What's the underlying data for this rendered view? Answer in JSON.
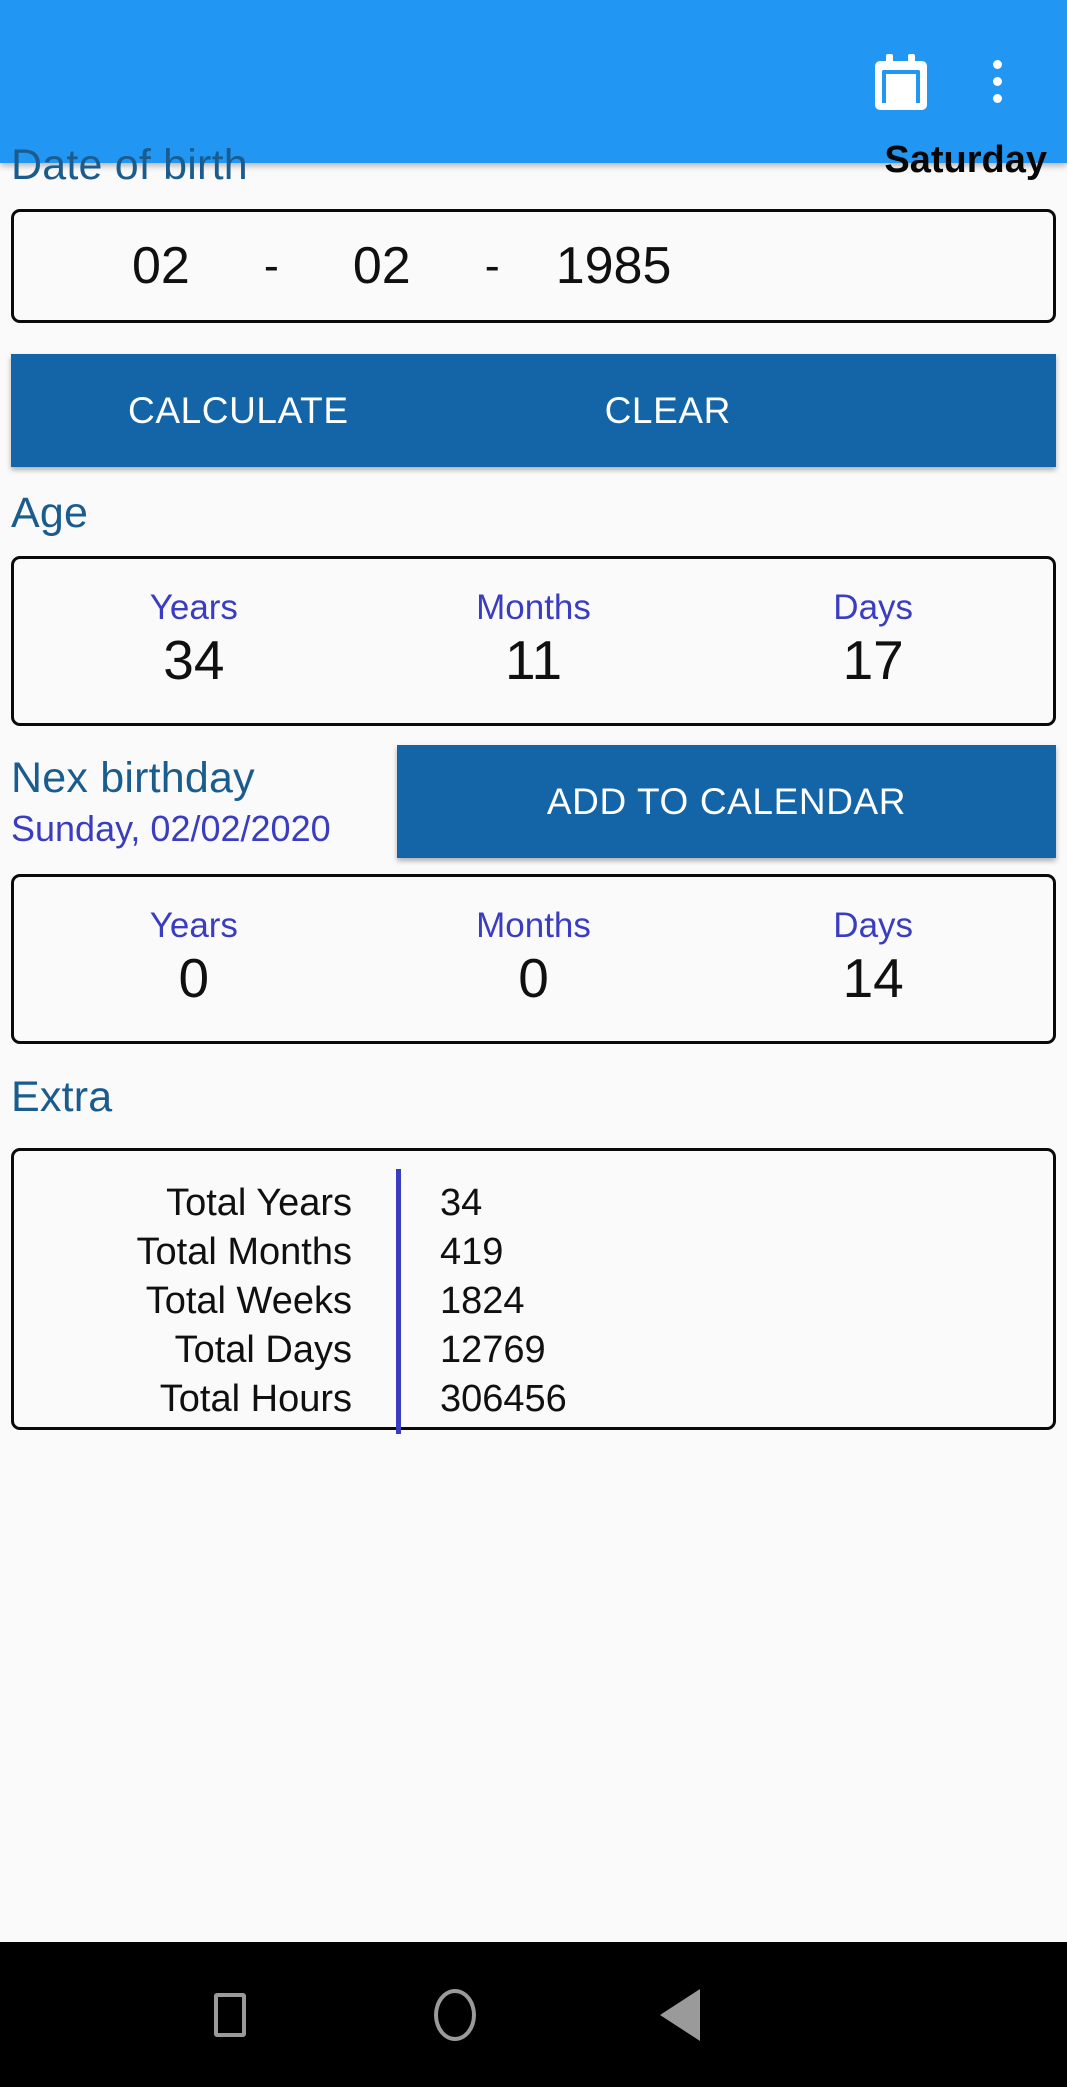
{
  "appbar": {
    "background": "#2196F3",
    "calendar_icon": "calendar-icon",
    "overflow_icon": "more-vertical-icon"
  },
  "dob": {
    "section_label": "Date of birth",
    "weekday": "Saturday",
    "day": "02",
    "month": "02",
    "year": "1985",
    "separator": "-"
  },
  "actions": {
    "calculate_label": "CALCULATE",
    "clear_label": "CLEAR",
    "button_color": "#1365A8"
  },
  "age": {
    "section_label": "Age",
    "columns": [
      {
        "label": "Years",
        "value": "34"
      },
      {
        "label": "Months",
        "value": "11"
      },
      {
        "label": "Days",
        "value": "17"
      }
    ]
  },
  "next_birthday": {
    "section_label": "Nex birthday",
    "date_text": "Sunday, 02/02/2020",
    "add_to_calendar_label": "ADD TO CALENDAR",
    "columns": [
      {
        "label": "Years",
        "value": "0"
      },
      {
        "label": "Months",
        "value": "0"
      },
      {
        "label": "Days",
        "value": "14"
      }
    ]
  },
  "extra": {
    "section_label": "Extra",
    "rows": [
      {
        "key": "Total Years",
        "value": "34"
      },
      {
        "key": "Total Months",
        "value": "419"
      },
      {
        "key": "Total Weeks",
        "value": "1824"
      },
      {
        "key": "Total Days",
        "value": "12769"
      },
      {
        "key": "Total Hours",
        "value": "306456"
      }
    ]
  },
  "navbar": {
    "recent_label": "recent-apps",
    "home_label": "home",
    "back_label": "back"
  },
  "colors": {
    "accent": "#2196F3",
    "button": "#1365A8",
    "heading": "#1A5C8E",
    "label": "#3B3DC0",
    "page_bg": "#FAFAFA"
  }
}
